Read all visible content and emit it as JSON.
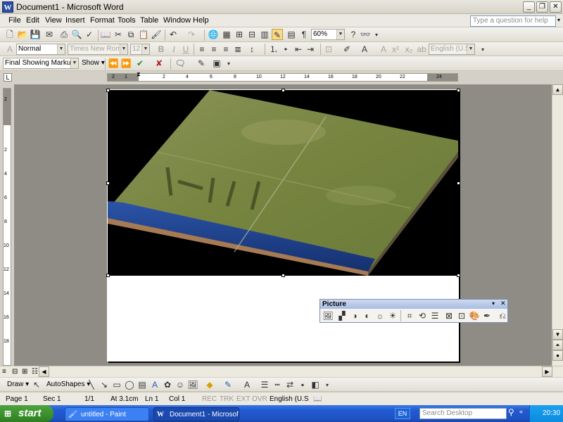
{
  "window": {
    "title": "Document1 - Microsoft Word",
    "icon": "word-app-icon"
  },
  "menu": [
    "File",
    "Edit",
    "View",
    "Insert",
    "Format",
    "Tools",
    "Table",
    "Window",
    "Help"
  ],
  "help_box": {
    "placeholder": "Type a question for help"
  },
  "standard_toolbar": {
    "zoom": "60%"
  },
  "formatting_toolbar": {
    "style": "Normal",
    "font": "Times New Roman",
    "size": "12",
    "language": "English (U.S.)"
  },
  "reviewing_toolbar": {
    "display": "Final Showing Markup",
    "show": "Show"
  },
  "ruler": {
    "h_labels": [
      "2",
      "1",
      "2",
      "4",
      "6",
      "8",
      "10",
      "12",
      "14",
      "16",
      "18",
      "20",
      "22",
      "24"
    ],
    "v_labels": [
      "2",
      "2",
      "4",
      "6",
      "8",
      "10",
      "12",
      "14",
      "16",
      "18"
    ]
  },
  "picture_toolbar": {
    "title": "Picture"
  },
  "drawing_toolbar": {
    "draw": "Draw",
    "autoshapes": "AutoShapes"
  },
  "status": {
    "page": "Page 1",
    "sec": "Sec 1",
    "pages": "1/1",
    "at": "At 3.1cm",
    "ln": "Ln 1",
    "col": "Col 1",
    "rec": "REC",
    "trk": "TRK",
    "ext": "EXT",
    "ovr": "OVR",
    "lang": "English (U.S"
  },
  "taskbar": {
    "start": "start",
    "tasks": [
      {
        "label": "untitled - Paint"
      },
      {
        "label": "Document1 - Microsof..."
      }
    ],
    "lang": "EN",
    "search": "Search Desktop",
    "clock": "20:30"
  },
  "colors": {
    "title_bg": "#dcd9cf",
    "taskbar": "#225ad0",
    "start": "#3a8f2b",
    "water": "#1f3f8c",
    "grass": "#7c8a4c"
  }
}
